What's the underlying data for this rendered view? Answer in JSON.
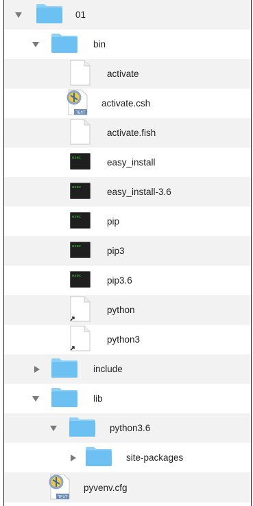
{
  "tree": {
    "root": "01",
    "bin": "bin",
    "activate": "activate",
    "activate_csh": "activate.csh",
    "activate_fish": "activate.fish",
    "easy_install": "easy_install",
    "easy_install_36": "easy_install-3.6",
    "pip": "pip",
    "pip3": "pip3",
    "pip36": "pip3.6",
    "python": "python",
    "python3": "python3",
    "include": "include",
    "lib": "lib",
    "python36": "python3.6",
    "site_packages": "site-packages",
    "pyvenv_cfg": "pyvenv.cfg"
  },
  "badges": {
    "exec": "exec",
    "text": "TEXT"
  },
  "colors": {
    "folder_top": "#8fd0f7",
    "folder_body": "#6cc0f2",
    "exec_bg": "#1f1f1f",
    "exec_text": "#3fd23f"
  },
  "icons": {
    "folder": "folder-icon",
    "document": "document-icon",
    "executable": "terminal-exec-icon",
    "text_doc": "text-document-icon",
    "alias": "alias-arrow-icon"
  }
}
